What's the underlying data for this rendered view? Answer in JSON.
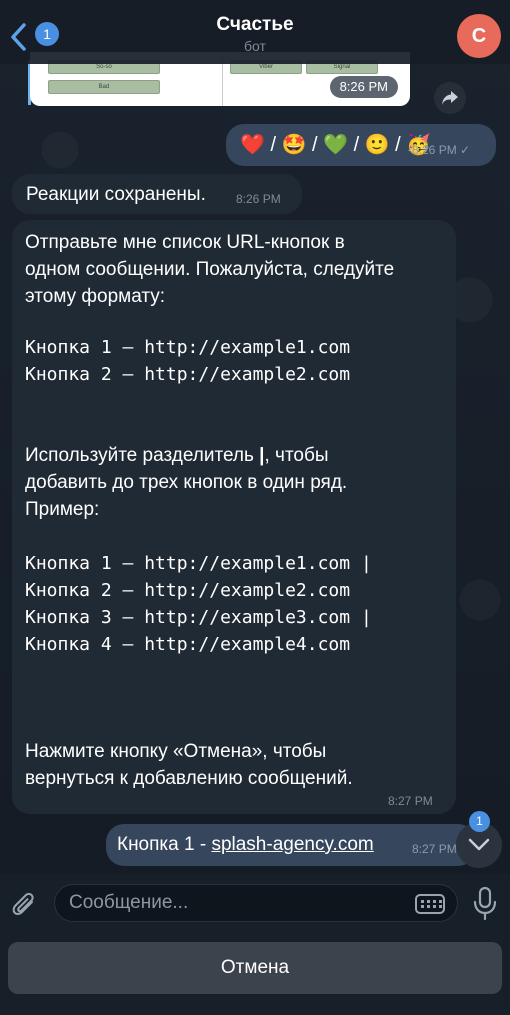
{
  "header": {
    "back_badge": "1",
    "title": "Счастье",
    "subtitle": "бот",
    "avatar_letter": "С"
  },
  "preview": {
    "buttons": [
      "So-so",
      "Bad",
      "Viber",
      "Signal"
    ],
    "time": "8:26 PM"
  },
  "messages": {
    "emoji_reaction": "❤️ / 🤩 / 💚 / 🙂 / 🥳",
    "emoji_time": "8:26 PM",
    "saved_text": "Реакции сохранены.",
    "saved_time": "8:26 PM",
    "instructions": {
      "p1_l1": "Отправьте мне список URL-кнопок в",
      "p1_l2": "одном сообщении. Пожалуйста, следуйте",
      "p1_l3": "этому формату:",
      "ex1": "Кнопка 1 – http://example1.com",
      "ex2": "Кнопка 2 – http://example2.com",
      "p2_l1a": "Используйте разделитель ",
      "p2_sep": "|",
      "p2_l1b": ", чтобы",
      "p2_l2": "добавить до трех кнопок в один ряд.",
      "p2_l3": "Пример:",
      "ex3": "Кнопка 1 – http://example1.com |",
      "ex4": "Кнопка 2 – http://example2.com",
      "ex5": "Кнопка 3 – http://example3.com |",
      "ex6": "Кнопка 4 – http://example4.com",
      "p3_l1": "Нажмите кнопку «Отмена», чтобы",
      "p3_l2": "вернуться к добавлению сообщений.",
      "time": "8:27 PM"
    },
    "reply_prefix": "Кнопка 1 - ",
    "reply_link": "splash-agency.com",
    "reply_time": "8:27 PM"
  },
  "scroll_badge": "1",
  "input": {
    "placeholder": "Сообщение..."
  },
  "cancel_label": "Отмена"
}
